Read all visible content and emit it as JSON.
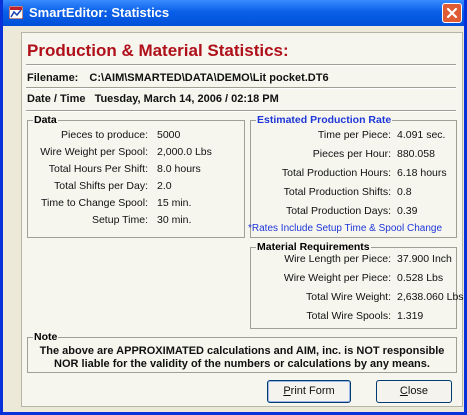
{
  "window": {
    "title": "SmartEditor: Statistics"
  },
  "heading": "Production & Material Statistics:",
  "filename": {
    "label": "Filename:",
    "value": "C:\\AIM\\SMARTED\\DATA\\DEMO\\Lit pocket.DT6"
  },
  "datetime": {
    "label": "Date / Time",
    "value": "Tuesday, March 14, 2006  /  02:18 PM"
  },
  "data_group": {
    "title": "Data",
    "rows": [
      {
        "label": "Pieces to produce:",
        "value": "5000"
      },
      {
        "label": "Wire Weight per Spool:",
        "value": "2,000.0 Lbs"
      },
      {
        "label": "Total Hours Per Shift:",
        "value": "8.0 hours"
      },
      {
        "label": "Total Shifts per Day:",
        "value": "2.0"
      },
      {
        "label": "Time to Change Spool:",
        "value": "15 min."
      },
      {
        "label": "Setup Time:",
        "value": "30 min."
      }
    ]
  },
  "rate_group": {
    "title": "Estimated Production Rate",
    "rows": [
      {
        "label": "Time per Piece:",
        "value": "4.091 sec."
      },
      {
        "label": "Pieces per Hour:",
        "value": "880.058"
      },
      {
        "label": "Total Production Hours:",
        "value": "6.18 hours"
      },
      {
        "label": "Total Production Shifts:",
        "value": "0.8"
      },
      {
        "label": "Total Production Days:",
        "value": "0.39"
      }
    ],
    "footnote": "*Rates Include Setup Time & Spool Change"
  },
  "material_group": {
    "title": "Material Requirements",
    "rows": [
      {
        "label": "Wire Length per Piece:",
        "value": "37.900 Inch"
      },
      {
        "label": "Wire Weight per Piece:",
        "value": "0.528 Lbs"
      },
      {
        "label": "Total Wire Weight:",
        "value": "2,638.060 Lbs"
      },
      {
        "label": "Total Wire Spools:",
        "value": "1.319"
      }
    ]
  },
  "note": {
    "title": "Note",
    "line1": "The above are APPROXIMATED calculations and AIM, inc. is NOT responsible",
    "line2": "NOR liable for the validity of the numbers or calculations by any means."
  },
  "buttons": {
    "print_mnemonic": "P",
    "print_rest": "rint Form",
    "close_mnemonic": "C",
    "close_rest": "lose"
  },
  "colors": {
    "heading": "#b0101a",
    "rates_note": "#1e36d8",
    "titlebar": "#0a5fe8"
  },
  "icons": {
    "app": "smarteditor-app-icon",
    "close": "close-icon"
  }
}
